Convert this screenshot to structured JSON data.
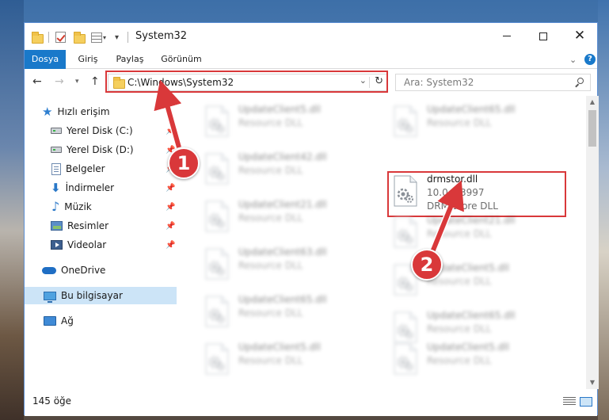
{
  "window": {
    "title": "System32"
  },
  "ribbon": {
    "tabs": [
      {
        "label": "Dosya"
      },
      {
        "label": "Giriş"
      },
      {
        "label": "Paylaş"
      },
      {
        "label": "Görünüm"
      }
    ],
    "help_label": "?"
  },
  "address": {
    "path": "C:\\Windows\\System32",
    "search_placeholder": "Ara: System32"
  },
  "sidebar": {
    "items": [
      {
        "label": "Hızlı erişim",
        "icon": "star-icon"
      },
      {
        "label": "Yerel Disk (C:)",
        "icon": "drive-icon",
        "pinned": true
      },
      {
        "label": "Yerel Disk (D:)",
        "icon": "drive-icon",
        "pinned": true
      },
      {
        "label": "Belgeler",
        "icon": "documents-icon",
        "pinned": true
      },
      {
        "label": "İndirmeler",
        "icon": "downloads-icon",
        "pinned": true
      },
      {
        "label": "Müzik",
        "icon": "music-icon",
        "pinned": true
      },
      {
        "label": "Resimler",
        "icon": "pictures-icon",
        "pinned": true
      },
      {
        "label": "Videolar",
        "icon": "videos-icon",
        "pinned": true
      },
      {
        "label": "OneDrive",
        "icon": "onedrive-icon"
      },
      {
        "label": "Bu bilgisayar",
        "icon": "computer-icon",
        "selected": true
      },
      {
        "label": "Ağ",
        "icon": "network-icon"
      }
    ]
  },
  "files": [
    {
      "name": "UpdateClient5.dll",
      "desc": "Resource DLL",
      "blurred": true
    },
    {
      "name": "UpdateClient65.dll",
      "desc": "Resource DLL",
      "blurred": true
    },
    {
      "name": "UpdateClient42.dll",
      "desc": "Resource DLL",
      "blurred": true
    },
    {
      "name": "drmstor.dll",
      "version": "10.0.0.3997",
      "desc": "DRM Store DLL",
      "blurred": false
    },
    {
      "name": "UpdateClient21.dll",
      "desc": "Resource DLL",
      "blurred": true
    },
    {
      "name": "UpdateClient21.dll",
      "desc": "Resource DLL",
      "blurred": true
    },
    {
      "name": "UpdateClient63.dll",
      "desc": "Resource DLL",
      "blurred": true
    },
    {
      "name": "UpdateClient5.dll",
      "desc": "Resource DLL",
      "blurred": true
    },
    {
      "name": "UpdateClient65.dll",
      "desc": "Resource DLL",
      "blurred": true
    },
    {
      "name": "UpdateClient65.dll",
      "desc": "Resource DLL",
      "blurred": true
    },
    {
      "name": "UpdateClient5.dll",
      "desc": "Resource DLL",
      "blurred": true
    },
    {
      "name": "UpdateClient5.dll",
      "desc": "Resource DLL",
      "blurred": true
    }
  ],
  "status": {
    "item_count": "145 öğe"
  },
  "callouts": [
    "1",
    "2"
  ],
  "colors": {
    "accent": "#1979ca",
    "highlight": "#d9383a",
    "selection": "#cce4f7"
  }
}
